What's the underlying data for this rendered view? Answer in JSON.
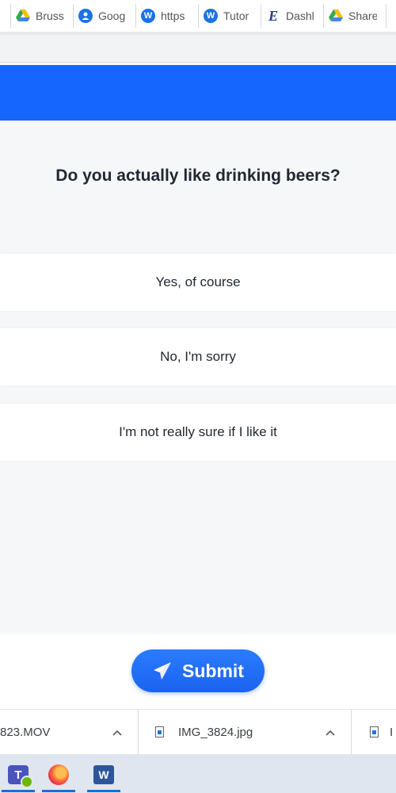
{
  "browser": {
    "tabs": [
      {
        "label": "",
        "icon": "tab-fragment"
      },
      {
        "label": "Bruss",
        "icon": "google-drive-icon"
      },
      {
        "label": "Goog",
        "icon": "google-account-icon"
      },
      {
        "label": "https",
        "icon": "w-logo-icon"
      },
      {
        "label": "Tutor",
        "icon": "w-logo-icon"
      },
      {
        "label": "Dashl",
        "icon": "e-logo-icon"
      },
      {
        "label": "Share",
        "icon": "google-drive-icon"
      }
    ]
  },
  "survey": {
    "question": "Do you actually like drinking beers?",
    "options": [
      "Yes, of course",
      "No, I'm sorry",
      "I'm not really sure if I like it"
    ],
    "submit_label": "Submit"
  },
  "downloads": [
    {
      "name": "823.MOV"
    },
    {
      "name": "IMG_3824.jpg"
    },
    {
      "name": "I"
    }
  ],
  "taskbar": {
    "apps": [
      "teams-icon",
      "firefox-icon",
      "word-icon"
    ]
  },
  "colors": {
    "accent": "#1565ff",
    "page_bg": "#f6f7f9",
    "text": "#1f2733"
  }
}
